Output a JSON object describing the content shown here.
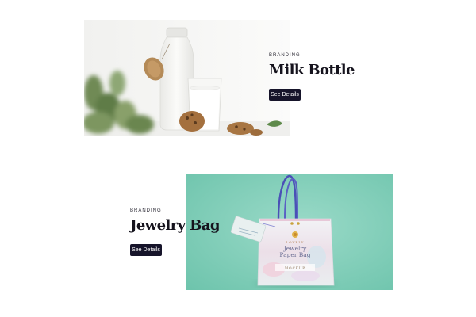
{
  "projects": [
    {
      "category": "BRANDING",
      "title": "Milk Bottle",
      "button_label": "See Details"
    },
    {
      "category": "BRANDING",
      "title": "Jewelry Bag",
      "button_label": "See Details"
    }
  ],
  "bag_print": {
    "brand": "LOVELY",
    "line1": "Jewelry",
    "line2": "Paper Bag",
    "footer": "MOCKUP"
  },
  "colors": {
    "button_bg": "#16142a",
    "heading": "#15131d",
    "bag_background": "#7fcdb8"
  }
}
